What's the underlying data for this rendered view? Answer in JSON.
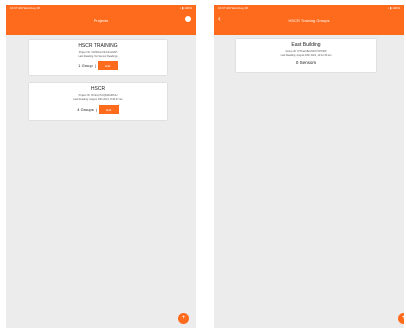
{
  "left_screen": {
    "status_left": "10:37 AM  Wed Aug 18",
    "status_right": "• ▮ 100%",
    "title": "Projects",
    "projects": [
      {
        "name": "HSCR TRAINING",
        "project_id": "Project ID: nVZSOonXdJmFrefsbH",
        "last_reading": "Last Reading: No Sensor Readings",
        "groups": "1 Group",
        "edit_label": "Edit"
      },
      {
        "name": "HSCR",
        "project_id": "Project ID: rhXkmpTxxQbWAFHaU",
        "last_reading": "Last Reading: August 19th 2021, 8:40:27 am",
        "groups": "4 Groups",
        "edit_label": "Edit"
      }
    ],
    "fab_label": "+"
  },
  "right_screen": {
    "status_left": "10:37 AM  Wed Aug 18",
    "status_right": "• ▮ 100%",
    "back_icon": "‹",
    "title": "HSCR Training Groups",
    "groups": [
      {
        "name": "East Building",
        "group_id": "Group ID: h7TbeknBoL5AXYFPO3W",
        "last_reading": "Last Reading: August 18th 2021, 10:12:30 am",
        "sensors": "0 Sensors"
      }
    ],
    "fab_label": "+"
  },
  "colors": {
    "accent": "#ff6b1c",
    "screen_bg": "#ececec",
    "card_bg": "#ffffff"
  }
}
